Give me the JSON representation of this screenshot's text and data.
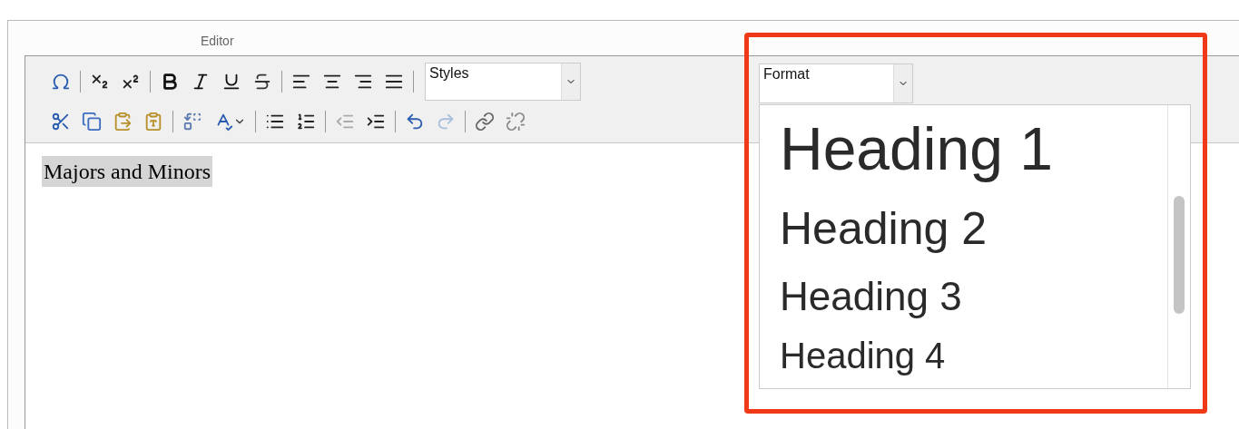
{
  "label": "Editor",
  "styles_select": {
    "value": "Styles"
  },
  "format_select": {
    "value": "Format"
  },
  "format_options": [
    {
      "label": "Heading 1"
    },
    {
      "label": "Heading 2"
    },
    {
      "label": "Heading 3"
    },
    {
      "label": "Heading 4"
    }
  ],
  "content": {
    "text": "Majors and Minors",
    "highlighted": true
  },
  "annotation": {
    "color": "#f03a17"
  }
}
